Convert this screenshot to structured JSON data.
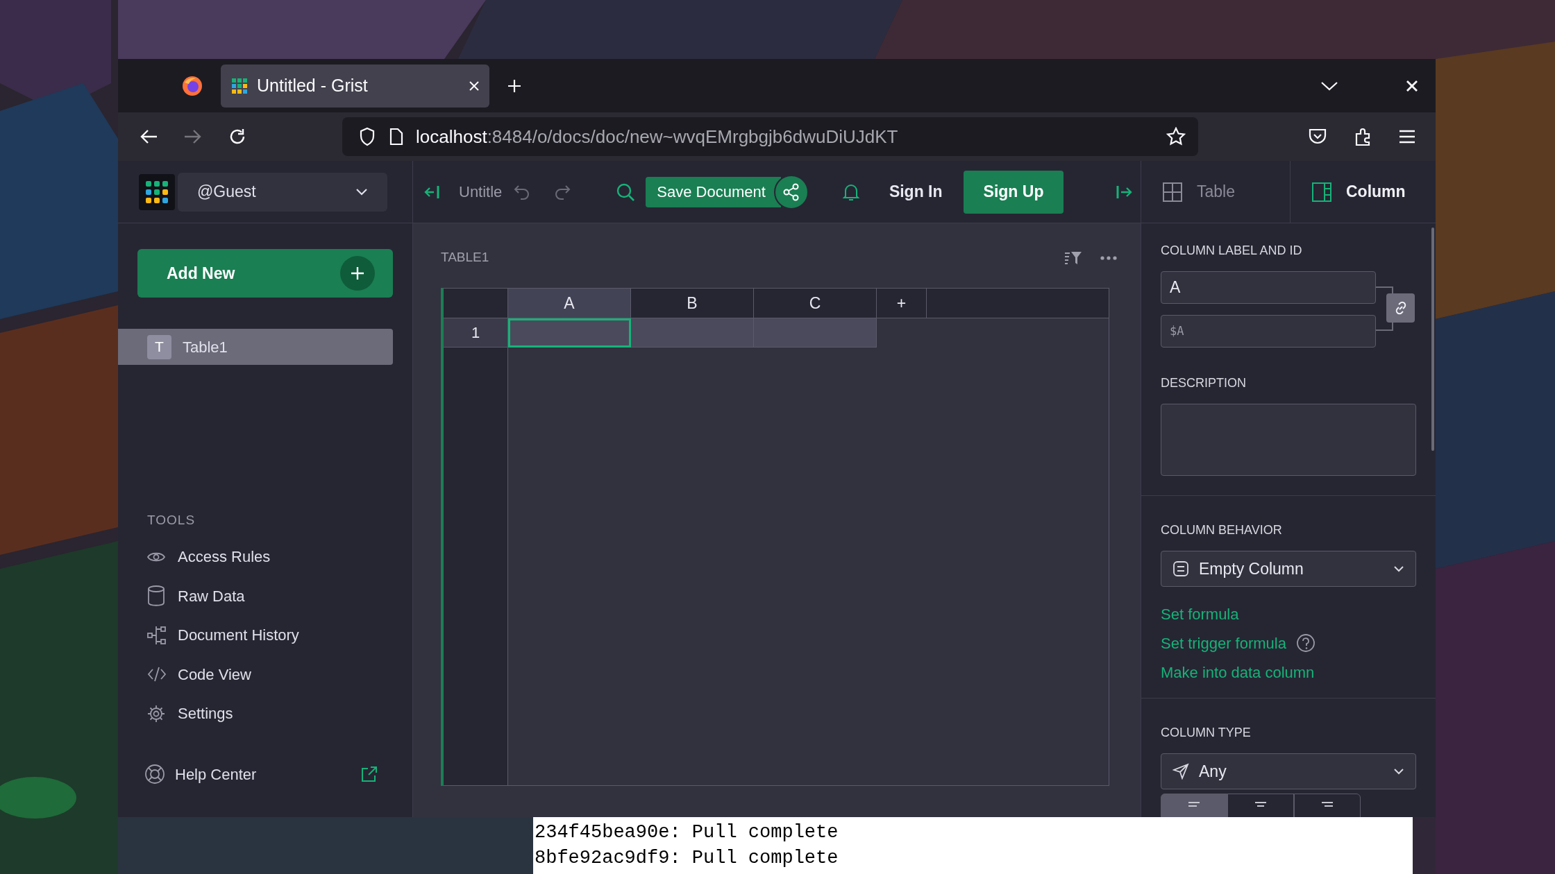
{
  "browser": {
    "tabs": [
      {
        "title": "Untitled - Grist",
        "selected": true
      }
    ],
    "url": {
      "host": "localhost",
      "rest": ":8484/o/docs/doc/new~wvqEMrgbgjb6dwuDiUJdKT"
    }
  },
  "app_header": {
    "account": "@Guest",
    "doc_title": "Untitle",
    "save_button": "Save Document",
    "sign_in": "Sign In",
    "sign_up": "Sign Up",
    "panel_tabs": [
      {
        "label": "Table",
        "selected": false
      },
      {
        "label": "Column",
        "selected": true
      }
    ]
  },
  "sidebar": {
    "add_new": "Add New",
    "pages": [
      {
        "letter": "T",
        "label": "Table1",
        "selected": true
      }
    ],
    "tools_heading": "TOOLS",
    "tools": [
      "Access Rules",
      "Raw Data",
      "Document History",
      "Code View",
      "Settings"
    ],
    "help": "Help Center"
  },
  "grid": {
    "title": "TABLE1",
    "columns": [
      {
        "label": "A",
        "selected": true
      },
      {
        "label": "B",
        "selected": false
      },
      {
        "label": "C",
        "selected": false
      }
    ],
    "add_column": "+",
    "rows": [
      {
        "number": "1"
      }
    ]
  },
  "right_panel": {
    "label_heading": "COLUMN LABEL AND ID",
    "label_value": "A",
    "id_value": "$A",
    "description_heading": "DESCRIPTION",
    "behavior_heading": "COLUMN BEHAVIOR",
    "behavior": "Empty Column",
    "links": [
      "Set formula",
      "Set trigger formula",
      "Make into data column"
    ],
    "type_heading": "COLUMN TYPE",
    "type": "Any",
    "alignment": [
      {
        "selected": true
      },
      {
        "selected": false
      },
      {
        "selected": false
      }
    ]
  },
  "terminal": {
    "lines": [
      "234f45bea90e: Pull complete",
      "8bfe92ac9df9: Pull complete"
    ]
  }
}
